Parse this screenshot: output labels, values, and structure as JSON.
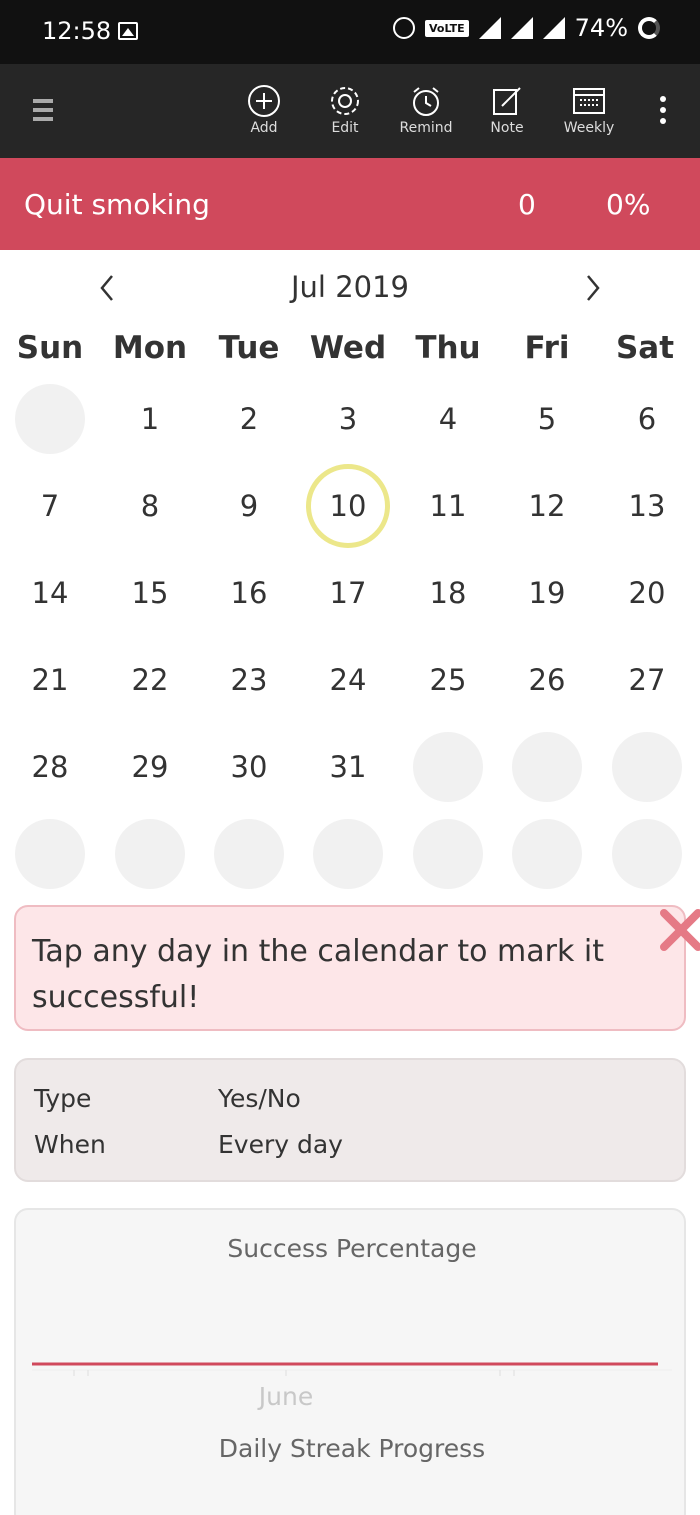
{
  "status_bar": {
    "time": "12:58",
    "volte": "VoLTE",
    "battery": "74%"
  },
  "toolbar": {
    "items": [
      {
        "label": "Add",
        "icon": "plus-circle-icon"
      },
      {
        "label": "Edit",
        "icon": "gear-icon"
      },
      {
        "label": "Remind",
        "icon": "alarm-clock-icon"
      },
      {
        "label": "Note",
        "icon": "edit-note-icon"
      },
      {
        "label": "Weekly",
        "icon": "calendar-icon"
      }
    ]
  },
  "habit": {
    "name": "Quit smoking",
    "count": "0",
    "percent": "0%",
    "color": "#d0495c"
  },
  "calendar": {
    "month_label": "Jul 2019",
    "weekdays": [
      "Sun",
      "Mon",
      "Tue",
      "Wed",
      "Thu",
      "Fri",
      "Sat"
    ],
    "days": [
      "",
      "1",
      "2",
      "3",
      "4",
      "5",
      "6",
      "7",
      "8",
      "9",
      "10",
      "11",
      "12",
      "13",
      "14",
      "15",
      "16",
      "17",
      "18",
      "19",
      "20",
      "21",
      "22",
      "23",
      "24",
      "25",
      "26",
      "27",
      "28",
      "29",
      "30",
      "31",
      "",
      "",
      "",
      "",
      "",
      "",
      "",
      "",
      "",
      ""
    ],
    "today": "10",
    "today_ring_color": "#ece78a"
  },
  "tip": {
    "text": "Tap any day in the calendar to mark it successful!"
  },
  "info": {
    "type_label": "Type",
    "type_value": "Yes/No",
    "when_label": "When",
    "when_value": "Every day"
  },
  "success_chart": {
    "title": "Success Percentage",
    "x_label": "June",
    "second_title": "Daily Streak Progress",
    "line_color": "#d0495c",
    "chart_data": {
      "type": "line",
      "x": [
        "June"
      ],
      "series": [
        {
          "values": [
            0
          ]
        }
      ],
      "title": "Success Percentage"
    }
  }
}
